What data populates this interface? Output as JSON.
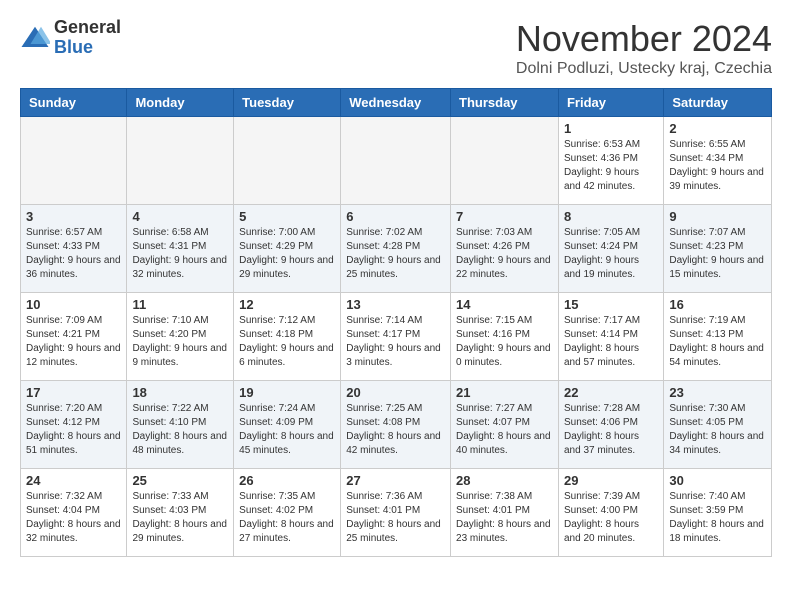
{
  "logo": {
    "general": "General",
    "blue": "Blue"
  },
  "header": {
    "month": "November 2024",
    "location": "Dolni Podluzi, Ustecky kraj, Czechia"
  },
  "weekdays": [
    "Sunday",
    "Monday",
    "Tuesday",
    "Wednesday",
    "Thursday",
    "Friday",
    "Saturday"
  ],
  "weeks": [
    [
      {
        "day": "",
        "info": ""
      },
      {
        "day": "",
        "info": ""
      },
      {
        "day": "",
        "info": ""
      },
      {
        "day": "",
        "info": ""
      },
      {
        "day": "",
        "info": ""
      },
      {
        "day": "1",
        "info": "Sunrise: 6:53 AM\nSunset: 4:36 PM\nDaylight: 9 hours and 42 minutes."
      },
      {
        "day": "2",
        "info": "Sunrise: 6:55 AM\nSunset: 4:34 PM\nDaylight: 9 hours and 39 minutes."
      }
    ],
    [
      {
        "day": "3",
        "info": "Sunrise: 6:57 AM\nSunset: 4:33 PM\nDaylight: 9 hours and 36 minutes."
      },
      {
        "day": "4",
        "info": "Sunrise: 6:58 AM\nSunset: 4:31 PM\nDaylight: 9 hours and 32 minutes."
      },
      {
        "day": "5",
        "info": "Sunrise: 7:00 AM\nSunset: 4:29 PM\nDaylight: 9 hours and 29 minutes."
      },
      {
        "day": "6",
        "info": "Sunrise: 7:02 AM\nSunset: 4:28 PM\nDaylight: 9 hours and 25 minutes."
      },
      {
        "day": "7",
        "info": "Sunrise: 7:03 AM\nSunset: 4:26 PM\nDaylight: 9 hours and 22 minutes."
      },
      {
        "day": "8",
        "info": "Sunrise: 7:05 AM\nSunset: 4:24 PM\nDaylight: 9 hours and 19 minutes."
      },
      {
        "day": "9",
        "info": "Sunrise: 7:07 AM\nSunset: 4:23 PM\nDaylight: 9 hours and 15 minutes."
      }
    ],
    [
      {
        "day": "10",
        "info": "Sunrise: 7:09 AM\nSunset: 4:21 PM\nDaylight: 9 hours and 12 minutes."
      },
      {
        "day": "11",
        "info": "Sunrise: 7:10 AM\nSunset: 4:20 PM\nDaylight: 9 hours and 9 minutes."
      },
      {
        "day": "12",
        "info": "Sunrise: 7:12 AM\nSunset: 4:18 PM\nDaylight: 9 hours and 6 minutes."
      },
      {
        "day": "13",
        "info": "Sunrise: 7:14 AM\nSunset: 4:17 PM\nDaylight: 9 hours and 3 minutes."
      },
      {
        "day": "14",
        "info": "Sunrise: 7:15 AM\nSunset: 4:16 PM\nDaylight: 9 hours and 0 minutes."
      },
      {
        "day": "15",
        "info": "Sunrise: 7:17 AM\nSunset: 4:14 PM\nDaylight: 8 hours and 57 minutes."
      },
      {
        "day": "16",
        "info": "Sunrise: 7:19 AM\nSunset: 4:13 PM\nDaylight: 8 hours and 54 minutes."
      }
    ],
    [
      {
        "day": "17",
        "info": "Sunrise: 7:20 AM\nSunset: 4:12 PM\nDaylight: 8 hours and 51 minutes."
      },
      {
        "day": "18",
        "info": "Sunrise: 7:22 AM\nSunset: 4:10 PM\nDaylight: 8 hours and 48 minutes."
      },
      {
        "day": "19",
        "info": "Sunrise: 7:24 AM\nSunset: 4:09 PM\nDaylight: 8 hours and 45 minutes."
      },
      {
        "day": "20",
        "info": "Sunrise: 7:25 AM\nSunset: 4:08 PM\nDaylight: 8 hours and 42 minutes."
      },
      {
        "day": "21",
        "info": "Sunrise: 7:27 AM\nSunset: 4:07 PM\nDaylight: 8 hours and 40 minutes."
      },
      {
        "day": "22",
        "info": "Sunrise: 7:28 AM\nSunset: 4:06 PM\nDaylight: 8 hours and 37 minutes."
      },
      {
        "day": "23",
        "info": "Sunrise: 7:30 AM\nSunset: 4:05 PM\nDaylight: 8 hours and 34 minutes."
      }
    ],
    [
      {
        "day": "24",
        "info": "Sunrise: 7:32 AM\nSunset: 4:04 PM\nDaylight: 8 hours and 32 minutes."
      },
      {
        "day": "25",
        "info": "Sunrise: 7:33 AM\nSunset: 4:03 PM\nDaylight: 8 hours and 29 minutes."
      },
      {
        "day": "26",
        "info": "Sunrise: 7:35 AM\nSunset: 4:02 PM\nDaylight: 8 hours and 27 minutes."
      },
      {
        "day": "27",
        "info": "Sunrise: 7:36 AM\nSunset: 4:01 PM\nDaylight: 8 hours and 25 minutes."
      },
      {
        "day": "28",
        "info": "Sunrise: 7:38 AM\nSunset: 4:01 PM\nDaylight: 8 hours and 23 minutes."
      },
      {
        "day": "29",
        "info": "Sunrise: 7:39 AM\nSunset: 4:00 PM\nDaylight: 8 hours and 20 minutes."
      },
      {
        "day": "30",
        "info": "Sunrise: 7:40 AM\nSunset: 3:59 PM\nDaylight: 8 hours and 18 minutes."
      }
    ]
  ]
}
